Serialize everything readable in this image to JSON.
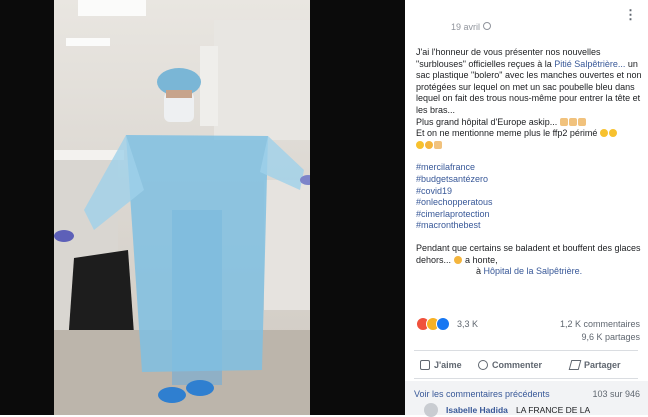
{
  "post": {
    "date": "19 avril",
    "paragraph1_a": "J'ai l'honneur de vous présenter nos nouvelles \"surblouses\" officielles reçues à la ",
    "hospital_link": "Pitié Salpêtrière...",
    "paragraph1_b": " un sac plastique \"bolero\" avec les manches ouvertes et non protégées sur lequel on met un sac poubelle bleu dans lequel on fait des trous nous-même pour entrer la tête et les bras...",
    "line_europe": "Plus grand hôpital d'Europe askip...",
    "line_ffp2": "Et on ne mentionne meme plus le ffp2 périmé",
    "hashtags": [
      "#mercilafrance",
      "#budgetsantézero",
      "#covid19",
      "#onlechopperatous",
      "#cimerlaprotection",
      "#macronthebest"
    ],
    "paragraph3_a": "Pendant que certains se baladent et bouffent des glaces dehors... ",
    "paragraph3_b": "a honte,",
    "location_prefix": "à ",
    "location_link": "Hôpital de la Salpêtrière."
  },
  "stats": {
    "reactions_count": "3,3 K",
    "comments_count": "1,2 K commentaires",
    "shares_count": "9,6 K partages"
  },
  "actions": {
    "like": "J'aime",
    "comment": "Commenter",
    "share": "Partager"
  },
  "comments": {
    "view_previous": "Voir les commentaires précédents",
    "pager": "103 sur 946",
    "first_author": "Isabelle Hadida",
    "first_text": "LA FRANCE DE LA"
  },
  "colors": {
    "link": "#385898",
    "meta": "#606770"
  },
  "icons": {
    "options": "more-icon",
    "privacy": "globe-icon",
    "like": "like-icon",
    "comment": "comment-icon",
    "share": "share-icon"
  }
}
